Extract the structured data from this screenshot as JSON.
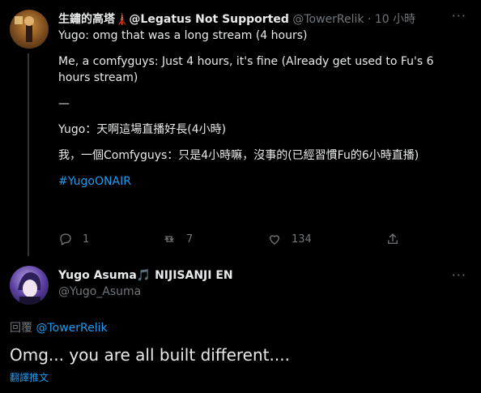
{
  "tweet1": {
    "display_name": "生鏽的高塔🗼@Legatus Not Supported",
    "handle": "@TowerRelik",
    "time": "· 10 小時",
    "more": "···",
    "lines": [
      "Yugo: omg that was a long stream (4 hours)",
      "",
      "Me, a comfyguys: Just 4 hours, it's fine (Already get used to Fu's 6 hours stream)",
      "",
      "—",
      "",
      "Yugo：天啊這場直播好長(4小時)",
      "",
      "我，一個Comfyguys：只是4小時嘛，沒事的(已經習慣Fu的6小時直播)",
      ""
    ],
    "hashtag": "#YugoONAIR",
    "actions": {
      "reply_count": "1",
      "retweet_count": "7",
      "like_count": "134"
    }
  },
  "tweet2": {
    "display_name": "Yugo Asuma🎵 NIJISANJI EN",
    "handle": "@Yugo_Asuma",
    "more": "···",
    "reply_prefix": "回覆",
    "reply_to": "@TowerRelik",
    "text": "Omg... you are all built different....",
    "translate": "翻譯推文"
  },
  "colors": {
    "background": "#000000",
    "link": "#1d9bf0",
    "muted": "#71767b",
    "text": "#e7e9ea"
  },
  "icons": [
    "reply-icon",
    "retweet-icon",
    "like-icon",
    "share-icon",
    "more-icon"
  ]
}
